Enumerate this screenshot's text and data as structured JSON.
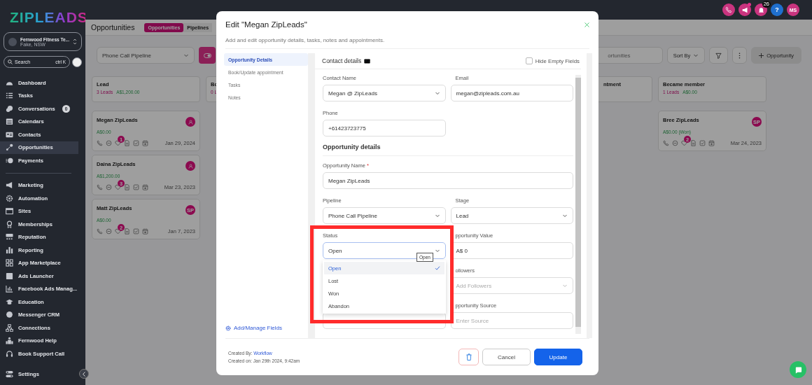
{
  "top_bar": {
    "notification_count": "26",
    "help": "?",
    "avatar_initials": "MS"
  },
  "sidebar": {
    "logo": "ZIPLEADS",
    "account": {
      "name": "Fernwood Fitness Te...",
      "location": "Fake, NSW"
    },
    "search": {
      "placeholder": "Search",
      "shortcut": "ctrl K"
    },
    "primary_items": [
      {
        "label": "Dashboard",
        "selected": false
      },
      {
        "label": "Tasks",
        "selected": false
      },
      {
        "label": "Conversations",
        "selected": false,
        "badge": "0"
      },
      {
        "label": "Calendars",
        "selected": false
      },
      {
        "label": "Contacts",
        "selected": false
      },
      {
        "label": "Opportunities",
        "selected": true
      },
      {
        "label": "Payments",
        "selected": false
      }
    ],
    "secondary_items": [
      {
        "label": "Marketing",
        "selected": false
      },
      {
        "label": "Automation",
        "selected": false
      },
      {
        "label": "Sites",
        "selected": false
      },
      {
        "label": "Memberships",
        "selected": false
      },
      {
        "label": "Reputation",
        "selected": false
      },
      {
        "label": "Reporting",
        "selected": false
      },
      {
        "label": "App Marketplace",
        "selected": false
      },
      {
        "label": "Ads Launcher",
        "selected": false
      },
      {
        "label": "Facebook Ads Manag...",
        "selected": false
      },
      {
        "label": "Education",
        "selected": false
      },
      {
        "label": "Messenger CRM",
        "selected": false
      },
      {
        "label": "Connections",
        "selected": false
      },
      {
        "label": "Fernwood Help",
        "selected": false
      },
      {
        "label": "Book Support Call",
        "selected": false
      }
    ],
    "settings": {
      "label": "Settings"
    }
  },
  "header": {
    "title": "Opportunities",
    "tabs": [
      {
        "label": "Opportunities",
        "selected": true
      },
      {
        "label": "Pipelines",
        "selected": false
      }
    ]
  },
  "toolbar": {
    "pipeline": "Phone Call Pipeline",
    "search_placeholder": "ortunities",
    "sort": "Sort By",
    "add_button": "Opportunity"
  },
  "columns": [
    {
      "kind": "full",
      "title": "Lead",
      "count": "3 Leads",
      "value": "A$1,200.00",
      "cards": [
        {
          "name": "Megan ZipLeads",
          "value": "A$0.00",
          "avatar": {
            "kind": "icon"
          },
          "task_count": "1",
          "date": "Jan 29, 2024"
        },
        {
          "name": "Daina ZipLeads",
          "value": "A$1,200.00",
          "avatar": {
            "kind": "icon"
          },
          "task_count": "3",
          "date": "Mar 23, 2023"
        },
        {
          "name": "Matt ZipLeads",
          "value": "A$0.00",
          "avatar": {
            "kind": "initials",
            "initials": "SP"
          },
          "task_count": "2",
          "date": "Jan 7, 2023"
        }
      ]
    },
    {
      "kind": "partial-left",
      "title": "Bo",
      "count": "0 L"
    },
    {
      "kind": "partial-right",
      "title": "ntment"
    },
    {
      "kind": "full",
      "title": "Became member",
      "count": "1 Leads",
      "value": "A$0.00",
      "cards": [
        {
          "name": "Bree ZipLeads",
          "value": "A$0.00 (Won)",
          "avatar": {
            "kind": "initials",
            "initials": "SP"
          },
          "task_count": "2",
          "date": "Mar 24, 2023"
        }
      ]
    }
  ],
  "modal": {
    "title": "Edit \"Megan ZipLeads\"",
    "subtitle": "Add and edit opportunity details, tasks, notes and appointments.",
    "nav": [
      {
        "label": "Opportunity Details",
        "selected": true
      },
      {
        "label": "Book/Update appointment",
        "selected": false
      },
      {
        "label": "Tasks",
        "selected": false
      },
      {
        "label": "Notes",
        "selected": false
      }
    ],
    "manage_fields": "Add/Manage Fields",
    "contact_section": {
      "title": "Contact details",
      "hide_empty": {
        "label": "Hide Empty Fields",
        "checked": false
      }
    },
    "contact_fields": {
      "left": [
        {
          "kind": "select",
          "label": "Contact Name",
          "value": "Megan @ ZipLeads"
        },
        {
          "kind": "text",
          "label": "Phone",
          "value": "+61423723775"
        }
      ],
      "right": [
        {
          "kind": "text",
          "label": "Email",
          "value": "megan@zipleads.com.au"
        }
      ]
    },
    "opportunity_section": {
      "title": "Opportunity details"
    },
    "name_field": {
      "kind": "text",
      "label": "Opportunity Name",
      "required_mark": "*",
      "value": "Megan ZipLeads"
    },
    "opportunity_fields": {
      "left": [
        {
          "kind": "select",
          "label": "Pipeline",
          "value": "Phone Call Pipeline"
        },
        {
          "kind": "select",
          "label": "Status",
          "value": "Open",
          "open": true,
          "tooltip": "Open",
          "options": [
            {
              "label": "Open",
              "selected": true
            },
            {
              "label": "Lost",
              "selected": false
            },
            {
              "label": "Won",
              "selected": false
            },
            {
              "label": "Abandon",
              "selected": false
            }
          ]
        },
        {
          "kind": "text"
        }
      ],
      "right": [
        {
          "kind": "select",
          "label": "Stage",
          "value": "Lead"
        },
        {
          "kind": "text",
          "label": "pportunity Value",
          "value": "A$ 0"
        },
        {
          "kind": "select",
          "label": "ollowers",
          "placeholder": "Add Followers"
        },
        {
          "kind": "text",
          "label": "pportunity Source",
          "placeholder": "Enter Source"
        }
      ]
    },
    "footer": {
      "created_by_label": "Created By:",
      "created_by": "Workflow",
      "created_on": "Created on: Jan 29th 2024, 9:42am",
      "buttons": [
        "Cancel",
        "Update"
      ]
    }
  }
}
